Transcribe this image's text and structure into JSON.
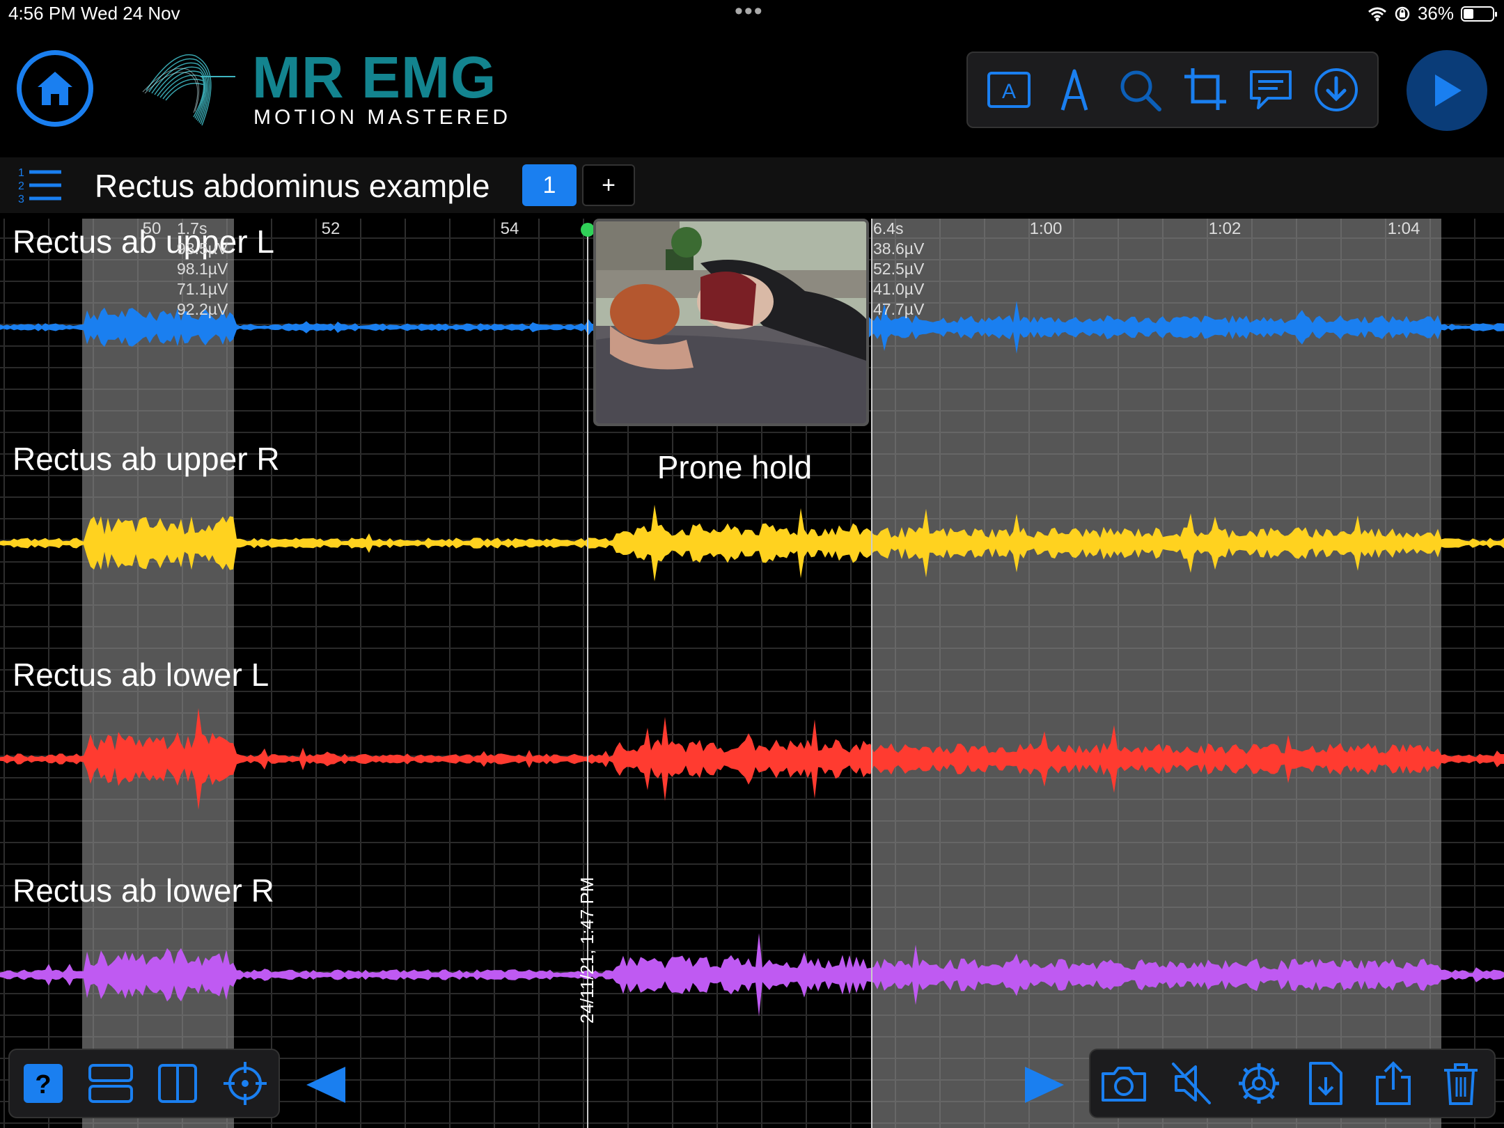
{
  "status_bar": {
    "time_date": "4:56 PM   Wed 24 Nov",
    "dots": "•••",
    "battery_text": "36%"
  },
  "header": {
    "brand_title": "MR EMG",
    "brand_subtitle": "MOTION MASTERED",
    "accent_color": "#1a7ff0",
    "brand_color": "#13848f",
    "toolbar_icons": [
      "text-box-icon",
      "pen-icon",
      "search-icon",
      "crop-icon",
      "comment-icon",
      "download-icon"
    ]
  },
  "session": {
    "title": "Rectus abdominus example",
    "page_number": "1",
    "add_label": "+"
  },
  "timeline": {
    "tick_labels": [
      "50",
      "52",
      "54",
      "1:00",
      "1:02",
      "1:04"
    ],
    "selection_a_label": "1.7s",
    "selection_b_label": "6.4s",
    "readout_a": [
      "93.5µV",
      "98.1µV",
      "71.1µV",
      "92.2µV"
    ],
    "readout_b": [
      "38.6µV",
      "52.5µV",
      "41.0µV",
      "47.7µV"
    ]
  },
  "channels": [
    {
      "name": "Rectus ab upper L",
      "color": "#1a7ff0"
    },
    {
      "name": "Rectus ab upper R",
      "color": "#ffd21f"
    },
    {
      "name": "Rectus ab lower L",
      "color": "#ff3b30"
    },
    {
      "name": "Rectus ab lower R",
      "color": "#bf5af2"
    }
  ],
  "video": {
    "caption": "Prone hold",
    "timestamp": "24/11/21, 1:47 PM"
  },
  "bottom_toolbar_left": [
    "help-icon",
    "stacked-view-icon",
    "split-view-icon",
    "target-icon"
  ],
  "bottom_toolbar_right": [
    "camera-icon",
    "mute-icon",
    "settings-icon",
    "import-file-icon",
    "share-icon",
    "trash-icon"
  ]
}
